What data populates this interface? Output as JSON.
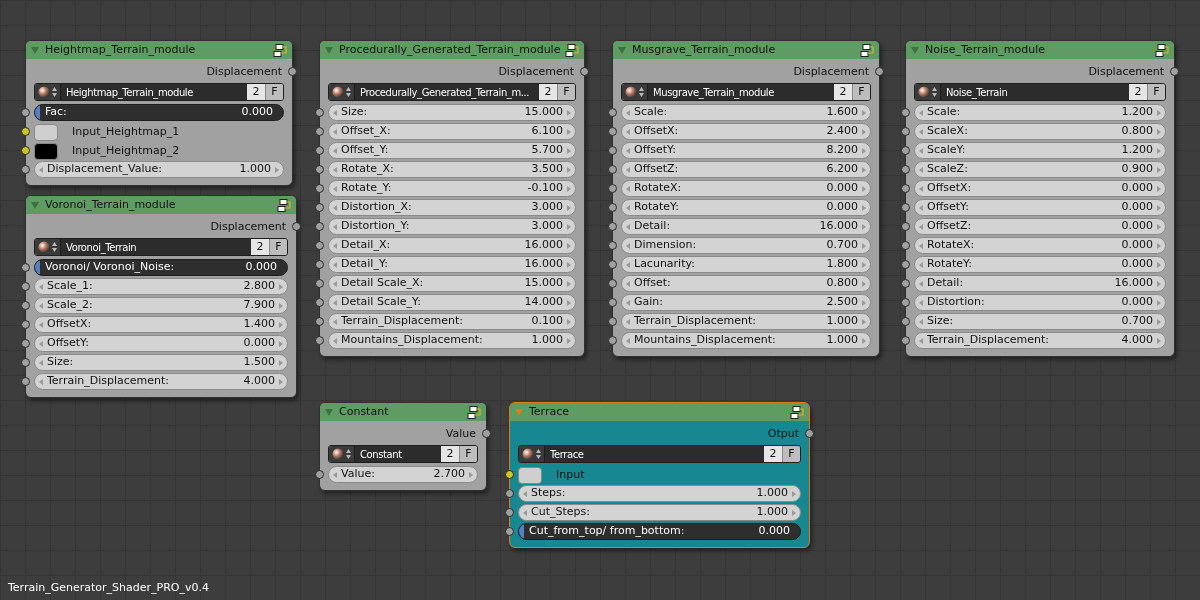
{
  "nodes": [
    {
      "title": "Heightmap_Terrain_module",
      "selected": false,
      "color": "#a1a1a1",
      "output": "Displacement",
      "datablock": {
        "name": "Heightmap_Terrain_module",
        "users": "2",
        "fake": "F"
      },
      "rows": [
        {
          "kind": "slider",
          "label": "Fac:",
          "value": "0.000",
          "level": 0
        },
        {
          "kind": "color",
          "label": "Input_Heightmap_1",
          "color": "#cfcfcf"
        },
        {
          "kind": "color",
          "label": "Input_Heightmap_2",
          "color": "#000000"
        },
        {
          "kind": "number",
          "label": "Displacement_Value:",
          "value": "1.000"
        }
      ]
    },
    {
      "title": "Voronoi_Terrain_module",
      "selected": false,
      "color": "#a1a1a1",
      "output": "Displacement",
      "datablock": {
        "name": "Voronoi_Terrain",
        "users": "2",
        "fake": "F"
      },
      "rows": [
        {
          "kind": "slider",
          "label": "Voronoi/ Voronoi_Noise:",
          "value": "0.000",
          "level": 0
        },
        {
          "kind": "number",
          "label": "Scale_1:",
          "value": "2.800"
        },
        {
          "kind": "number",
          "label": "Scale_2:",
          "value": "7.900"
        },
        {
          "kind": "number",
          "label": "OffsetX:",
          "value": "1.400"
        },
        {
          "kind": "number",
          "label": "OffsetY:",
          "value": "0.000"
        },
        {
          "kind": "number",
          "label": "Size:",
          "value": "1.500"
        },
        {
          "kind": "number",
          "label": "Terrain_Displacement:",
          "value": "4.000"
        }
      ]
    },
    {
      "title": "Procedurally_Generated_Terrain_module",
      "selected": false,
      "color": "#a1a1a1",
      "output": "Displacement",
      "datablock": {
        "name": "Procedurally_Generated_Terrain_m...",
        "users": "2",
        "fake": "F"
      },
      "rows": [
        {
          "kind": "number",
          "label": "Size:",
          "value": "15.000"
        },
        {
          "kind": "number",
          "label": "Offset_X:",
          "value": "6.100"
        },
        {
          "kind": "number",
          "label": "Offset_Y:",
          "value": "5.700"
        },
        {
          "kind": "number",
          "label": "Rotate_X:",
          "value": "3.500"
        },
        {
          "kind": "number",
          "label": "Rotate_Y:",
          "value": "-0.100"
        },
        {
          "kind": "number",
          "label": "Distortion_X:",
          "value": "3.000"
        },
        {
          "kind": "number",
          "label": "Distortion_Y:",
          "value": "3.000"
        },
        {
          "kind": "number",
          "label": "Detail_X:",
          "value": "16.000"
        },
        {
          "kind": "number",
          "label": "Detail_Y:",
          "value": "16.000"
        },
        {
          "kind": "number",
          "label": "Detail Scale_X:",
          "value": "15.000"
        },
        {
          "kind": "number",
          "label": "Detail Scale_Y:",
          "value": "14.000"
        },
        {
          "kind": "number",
          "label": "Terrain_Displacement:",
          "value": "0.100"
        },
        {
          "kind": "number",
          "label": "Mountains_Displacement:",
          "value": "1.000"
        }
      ]
    },
    {
      "title": "Musgrave_Terrain_module",
      "selected": false,
      "color": "#a1a1a1",
      "output": "Displacement",
      "datablock": {
        "name": "Musgrave_Terrain_module",
        "users": "2",
        "fake": "F"
      },
      "rows": [
        {
          "kind": "number",
          "label": "Scale:",
          "value": "1.600"
        },
        {
          "kind": "number",
          "label": "OffsetX:",
          "value": "2.400"
        },
        {
          "kind": "number",
          "label": "OffsetY:",
          "value": "8.200"
        },
        {
          "kind": "number",
          "label": "OffsetZ:",
          "value": "6.200"
        },
        {
          "kind": "number",
          "label": "RotateX:",
          "value": "0.000"
        },
        {
          "kind": "number",
          "label": "RotateY:",
          "value": "0.000"
        },
        {
          "kind": "number",
          "label": "Detail:",
          "value": "16.000"
        },
        {
          "kind": "number",
          "label": "Dimension:",
          "value": "0.700"
        },
        {
          "kind": "number",
          "label": "Lacunarity:",
          "value": "1.800"
        },
        {
          "kind": "number",
          "label": "Offset:",
          "value": "0.800"
        },
        {
          "kind": "number",
          "label": "Gain:",
          "value": "2.500"
        },
        {
          "kind": "number",
          "label": "Terrain_Displacement:",
          "value": "1.000"
        },
        {
          "kind": "number",
          "label": "Mountains_Displacement:",
          "value": "1.000"
        }
      ]
    },
    {
      "title": "Noise_Terrain_module",
      "selected": false,
      "color": "#a1a1a1",
      "output": "Displacement",
      "datablock": {
        "name": "Noise_Terrain",
        "users": "2",
        "fake": "F"
      },
      "rows": [
        {
          "kind": "number",
          "label": "Scale:",
          "value": "1.200"
        },
        {
          "kind": "number",
          "label": "ScaleX:",
          "value": "0.800"
        },
        {
          "kind": "number",
          "label": "ScaleY:",
          "value": "1.200"
        },
        {
          "kind": "number",
          "label": "ScaleZ:",
          "value": "0.900"
        },
        {
          "kind": "number",
          "label": "OffsetX:",
          "value": "0.000"
        },
        {
          "kind": "number",
          "label": "OffsetY:",
          "value": "0.000"
        },
        {
          "kind": "number",
          "label": "OffsetZ:",
          "value": "0.000"
        },
        {
          "kind": "number",
          "label": "RotateX:",
          "value": "0.000"
        },
        {
          "kind": "number",
          "label": "RotateY:",
          "value": "0.000"
        },
        {
          "kind": "number",
          "label": "Detail:",
          "value": "16.000"
        },
        {
          "kind": "number",
          "label": "Distortion:",
          "value": "0.000"
        },
        {
          "kind": "number",
          "label": "Size:",
          "value": "0.700"
        },
        {
          "kind": "number",
          "label": "Terrain_Displacement:",
          "value": "4.000"
        }
      ]
    },
    {
      "title": "Constant",
      "selected": false,
      "color": "#a1a1a1",
      "output": "Value",
      "datablock": {
        "name": "Constant",
        "users": "2",
        "fake": "F"
      },
      "rows": [
        {
          "kind": "number",
          "label": "Value:",
          "value": "2.700"
        }
      ]
    },
    {
      "title": "Terrace",
      "selected": true,
      "color": "#178892",
      "output": "Otput",
      "datablock": {
        "name": "Terrace",
        "users": "2",
        "fake": "F"
      },
      "rows": [
        {
          "kind": "color",
          "label": "Input",
          "color": "#cfcfcf"
        },
        {
          "kind": "number",
          "label": "Steps:",
          "value": "1.000"
        },
        {
          "kind": "number",
          "label": "Cut_Steps:",
          "value": "1.000"
        },
        {
          "kind": "slider",
          "label": "Cut_from_top/ from_bottom:",
          "value": "0.000",
          "level": 0
        }
      ]
    }
  ],
  "footer": "Terrain_Generator_Shader_PRO_v0.4"
}
